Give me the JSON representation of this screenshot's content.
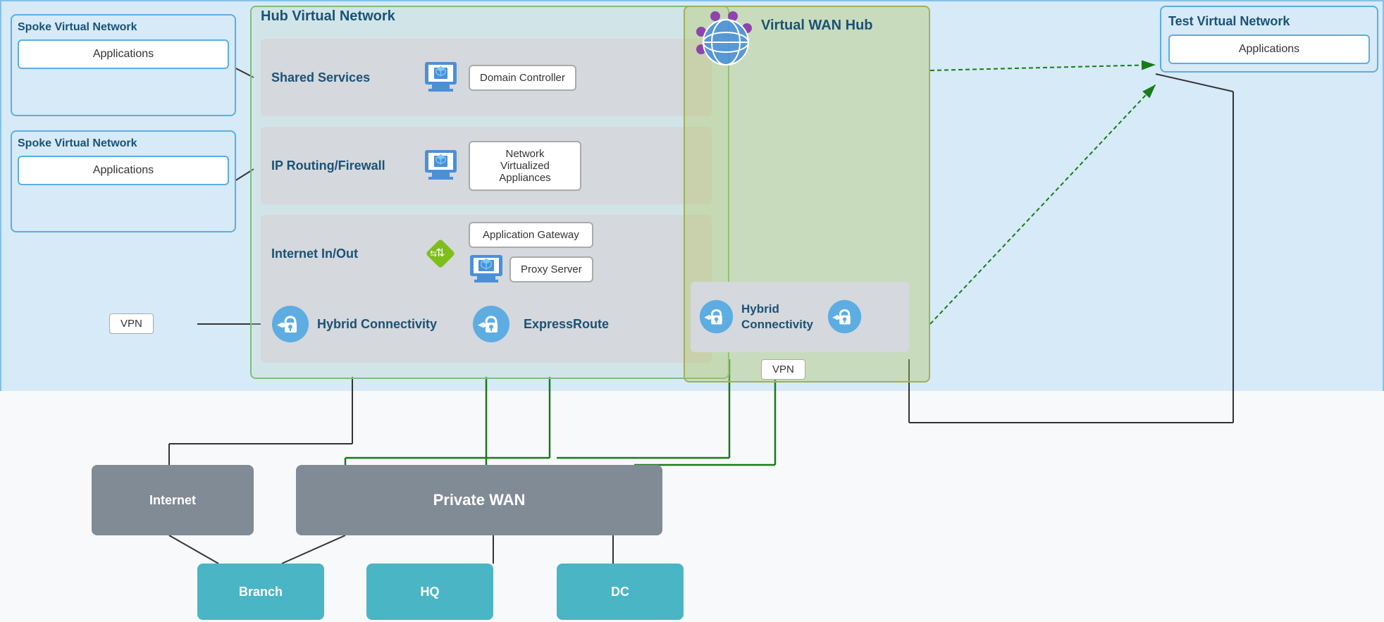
{
  "spoke1": {
    "title": "Spoke Virtual Network",
    "app_label": "Applications"
  },
  "spoke2": {
    "title": "Spoke Virtual Network",
    "app_label": "Applications"
  },
  "hub": {
    "title": "Hub Virtual Network",
    "rows": [
      {
        "id": "shared",
        "label": "Shared Services",
        "service": "Domain Controller"
      },
      {
        "id": "routing",
        "label": "IP Routing/Firewall",
        "service": "Network  Virtualized\nAppliances"
      },
      {
        "id": "internet",
        "label": "Internet In/Out",
        "service1": "Application Gateway",
        "service2": "Proxy Server"
      },
      {
        "id": "hybrid",
        "label": "Hybrid Connectivity",
        "service": "ExpressRoute"
      }
    ]
  },
  "wan_hub": {
    "title": "Virtual WAN Hub",
    "hybrid_label": "Hybrid\nConnectivity",
    "vpn_label": "VPN"
  },
  "test_vnet": {
    "title": "Test Virtual Network",
    "app_label": "Applications"
  },
  "vpn_left": "VPN",
  "bottom": {
    "internet": "Internet",
    "private_wan": "Private WAN",
    "branch": "Branch",
    "hq": "HQ",
    "dc": "DC"
  }
}
